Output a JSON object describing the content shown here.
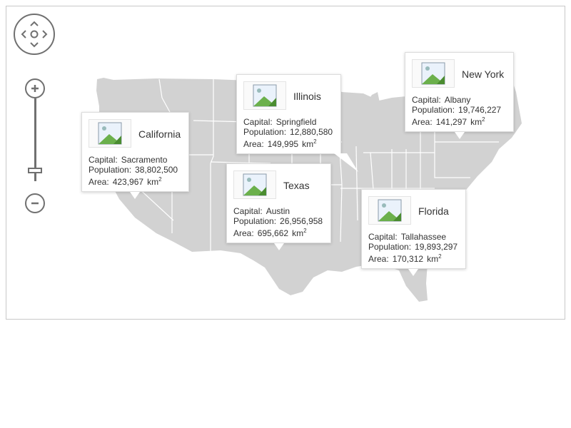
{
  "map": {
    "land_color": "#d2d2d2",
    "border_color": "#ffffff"
  },
  "controls": {
    "pan_icon": "pan-arrows-icon",
    "zoom_in_icon": "plus-icon",
    "zoom_out_icon": "minus-icon",
    "zoom_level": 0.1
  },
  "labels": {
    "capital": "Capital:",
    "population": "Population:",
    "area": "Area:",
    "unit": "km"
  },
  "states": [
    {
      "name": "California",
      "capital": "Sacramento",
      "population": "38,802,500",
      "area": "423,967"
    },
    {
      "name": "Illinois",
      "capital": "Springfield",
      "population": "12,880,580",
      "area": "149,995"
    },
    {
      "name": "New York",
      "capital": "Albany",
      "population": "19,746,227",
      "area": "141,297"
    },
    {
      "name": "Texas",
      "capital": "Austin",
      "population": "26,956,958",
      "area": "695,662"
    },
    {
      "name": "Florida",
      "capital": "Tallahassee",
      "population": "19,893,297",
      "area": "170,312"
    }
  ]
}
